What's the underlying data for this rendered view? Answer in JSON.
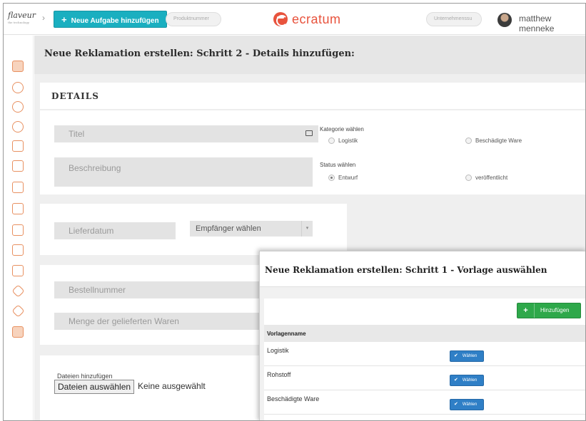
{
  "brand": {
    "name": "flaveur",
    "tagline": "the technology"
  },
  "header": {
    "new_task_label": "Neue Aufgabe hinzufügen",
    "product_number_placeholder": "Produktnummer",
    "logo_text": "ecratum",
    "company_placeholder": "Unternehmenssu",
    "username": "matthew menneke"
  },
  "page": {
    "title": "Neue Reklamation erstellen: Schritt 2 - Details hinzufügen:"
  },
  "details": {
    "heading": "DETAILS",
    "title_placeholder": "Titel",
    "description_placeholder": "Beschreibung",
    "category_label": "Kategorie wählen",
    "category_options": [
      "Logistik",
      "Beschädigte Ware"
    ],
    "status_label": "Status wählen",
    "status_options": [
      "Entwurf",
      "veröffentlicht"
    ],
    "status_selected": "Entwurf",
    "delivery_date_placeholder": "Lieferdatum",
    "recipient_select": "Empfänger wählen",
    "order_number_placeholder": "Bestellnummer",
    "quantity_placeholder": "Menge der gelieferten Waren",
    "files_label": "Dateien hinzufügen",
    "file_button": "Dateien auswählen",
    "file_none": "Keine ausgewählt"
  },
  "modal": {
    "title": "Neue Reklamation erstellen: Schritt 1 - Vorlage auswählen",
    "add_button": "Hinzufügen",
    "column_header": "Vorlagenname",
    "rows": [
      {
        "name": "Logistik",
        "action": "Wählen"
      },
      {
        "name": "Rohstoff",
        "action": "Wählen"
      },
      {
        "name": "Beschädigte Ware",
        "action": "Wählen"
      }
    ]
  },
  "colors": {
    "accent": "#1aafc0",
    "brand": "#e8533d",
    "sidebar_icon": "#e89060",
    "add_green": "#2ea84a",
    "pick_blue": "#2f7fc6"
  }
}
